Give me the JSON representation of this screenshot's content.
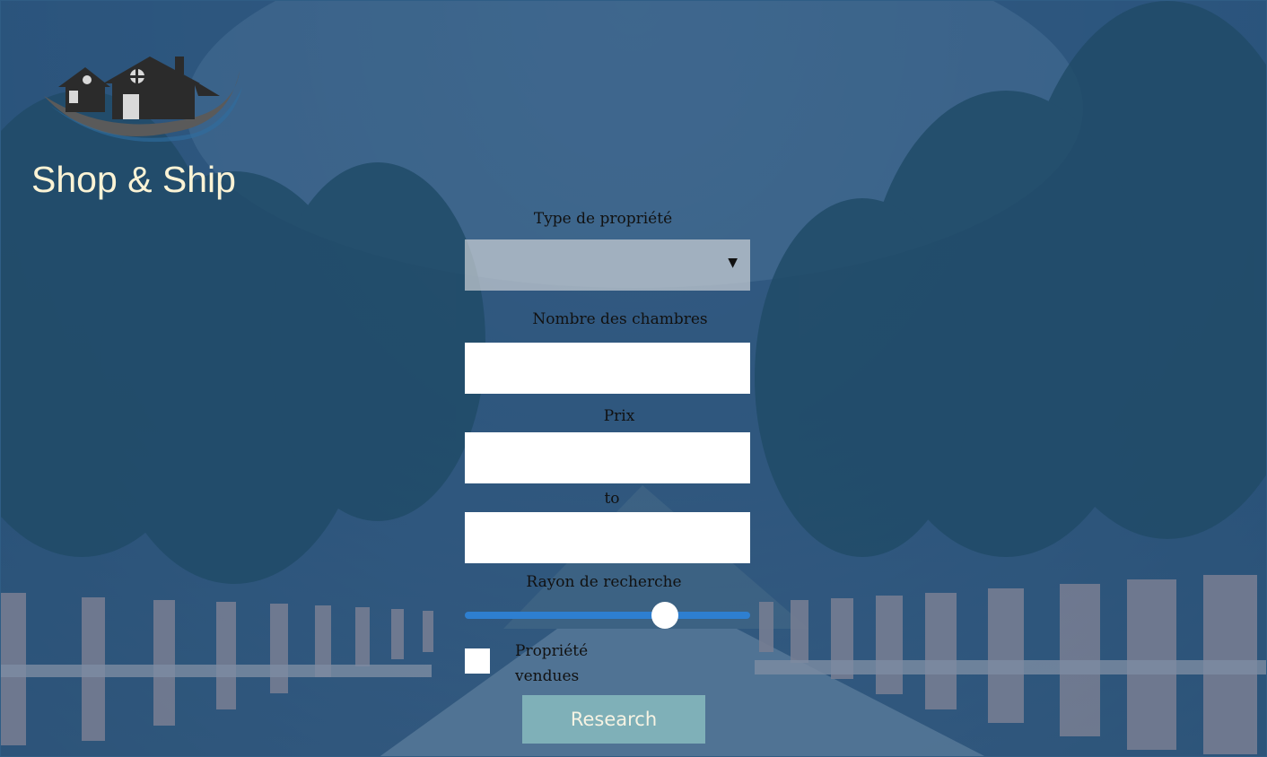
{
  "brand": {
    "name": "Shop & Ship",
    "logo_icon": "house-roof-logo-icon"
  },
  "form": {
    "property_type": {
      "label": "Type de propriété",
      "selected_value": "",
      "arrow_icon": "dropdown-arrow-icon"
    },
    "rooms": {
      "label": "Nombre des chambres",
      "value": ""
    },
    "price_from": {
      "label": "Prix",
      "value": ""
    },
    "price_to": {
      "label": "to",
      "value": ""
    },
    "search_radius": {
      "label": "Rayon de recherche",
      "level_fraction": 0.7
    },
    "sold_properties": {
      "label": "Propriété vendues",
      "checked": false
    },
    "submit_label": "Research"
  },
  "colors": {
    "brand_text": "#fbf3d5",
    "button_bg": "#7fb0b8",
    "slider": "#2e7fd0",
    "overlay": "#2f5d85"
  }
}
